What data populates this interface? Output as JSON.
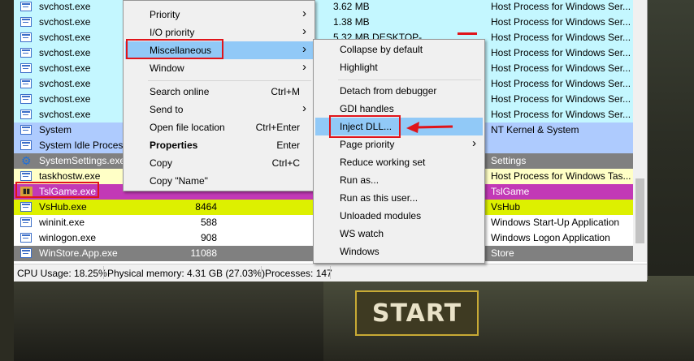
{
  "background": {
    "start_label": "START",
    "colors": {
      "start_border": "#c8aa35",
      "start_bg": "#3e3a22"
    }
  },
  "processes": [
    {
      "name": "svchost.exe",
      "pid": "",
      "memory": "3.62 MB",
      "description": "Host Process for Windows Ser...",
      "color": "#c4f7ff"
    },
    {
      "name": "svchost.exe",
      "pid": "",
      "memory": "1.38 MB",
      "description": "Host Process for Windows Ser...",
      "color": "#c4f7ff"
    },
    {
      "name": "svchost.exe",
      "pid": "",
      "memory": "5.32 MB   DESKTOP-",
      "description": "Host Process for Windows Ser...",
      "color": "#c4f7ff"
    },
    {
      "name": "svchost.exe",
      "pid": "",
      "memory": "",
      "description": "Host Process for Windows Ser...",
      "color": "#c4f7ff"
    },
    {
      "name": "svchost.exe",
      "pid": "",
      "memory": "",
      "description": "Host Process for Windows Ser...",
      "color": "#c4f7ff"
    },
    {
      "name": "svchost.exe",
      "pid": "",
      "memory": "",
      "description": "Host Process for Windows Ser...",
      "color": "#c4f7ff"
    },
    {
      "name": "svchost.exe",
      "pid": "",
      "memory": "",
      "description": "Host Process for Windows Ser...",
      "color": "#c4f7ff"
    },
    {
      "name": "svchost.exe",
      "pid": "",
      "memory": "",
      "description": "Host Process for Windows Ser...",
      "color": "#c4f7ff"
    },
    {
      "name": "System",
      "pid": "",
      "memory": "",
      "description": "NT Kernel & System",
      "color": "#aecbfe"
    },
    {
      "name": "System Idle Process",
      "pid": "",
      "memory": "",
      "description": "",
      "color": "#aecbfe"
    },
    {
      "name": "SystemSettings.exe",
      "pid": "",
      "memory": "",
      "description": "Settings",
      "color": "#808080",
      "icon": "gear-icon"
    },
    {
      "name": "taskhostw.exe",
      "pid": "",
      "memory": "",
      "description": "Host Process for Windows Tas...",
      "color": "#ffffc6"
    },
    {
      "name": "TslGame.exe",
      "pid": "",
      "memory": "",
      "description": "TslGame",
      "color": "#c239b6",
      "icon": "pubg-icon"
    },
    {
      "name": "VsHub.exe",
      "pid": "8464",
      "memory": "",
      "description": "VsHub",
      "color": "#ddf000"
    },
    {
      "name": "wininit.exe",
      "pid": "588",
      "memory": "",
      "description": "Windows Start-Up Application",
      "color": "#ffffff"
    },
    {
      "name": "winlogon.exe",
      "pid": "908",
      "memory": "",
      "description": "Windows Logon Application",
      "color": "#ffffff"
    },
    {
      "name": "WinStore.App.exe",
      "pid": "11088",
      "memory": "",
      "description": "Store",
      "color": "#808080"
    }
  ],
  "status_bar": {
    "cpu": "CPU Usage: 18.25%",
    "memory": "Physical memory: 4.31 GB (27.03%)",
    "processes": "Processes: 147"
  },
  "main_menu": {
    "items": [
      {
        "label": "Priority",
        "shortcut": "",
        "submenu": true
      },
      {
        "label": "I/O priority",
        "shortcut": "",
        "submenu": true
      },
      {
        "label": "Miscellaneous",
        "shortcut": "",
        "submenu": true,
        "highlighted": true
      },
      {
        "label": "Window",
        "shortcut": "",
        "submenu": true
      },
      {
        "label": "Search online",
        "shortcut": "Ctrl+M",
        "submenu": false
      },
      {
        "label": "Send to",
        "shortcut": "",
        "submenu": true
      },
      {
        "label": "Open file location",
        "shortcut": "Ctrl+Enter",
        "submenu": false
      },
      {
        "label": "Properties",
        "shortcut": "Enter",
        "submenu": false,
        "bold": true
      },
      {
        "label": "Copy",
        "shortcut": "Ctrl+C",
        "submenu": false
      },
      {
        "label": "Copy \"Name\"",
        "shortcut": "",
        "submenu": false
      }
    ]
  },
  "misc_menu": {
    "items": [
      {
        "label": "Collapse by default",
        "submenu": false
      },
      {
        "label": "Highlight",
        "submenu": false
      },
      {
        "label": "Detach from debugger",
        "submenu": false
      },
      {
        "label": "GDI handles",
        "submenu": false
      },
      {
        "label": "Inject DLL...",
        "submenu": false,
        "highlighted": true
      },
      {
        "label": "Page priority",
        "submenu": true
      },
      {
        "label": "Reduce working set",
        "submenu": false
      },
      {
        "label": "Run as...",
        "submenu": false
      },
      {
        "label": "Run as this user...",
        "submenu": false
      },
      {
        "label": "Unloaded modules",
        "submenu": false
      },
      {
        "label": "WS watch",
        "submenu": false
      },
      {
        "label": "Windows",
        "submenu": false
      }
    ]
  },
  "annotation_color": "#e0141a"
}
